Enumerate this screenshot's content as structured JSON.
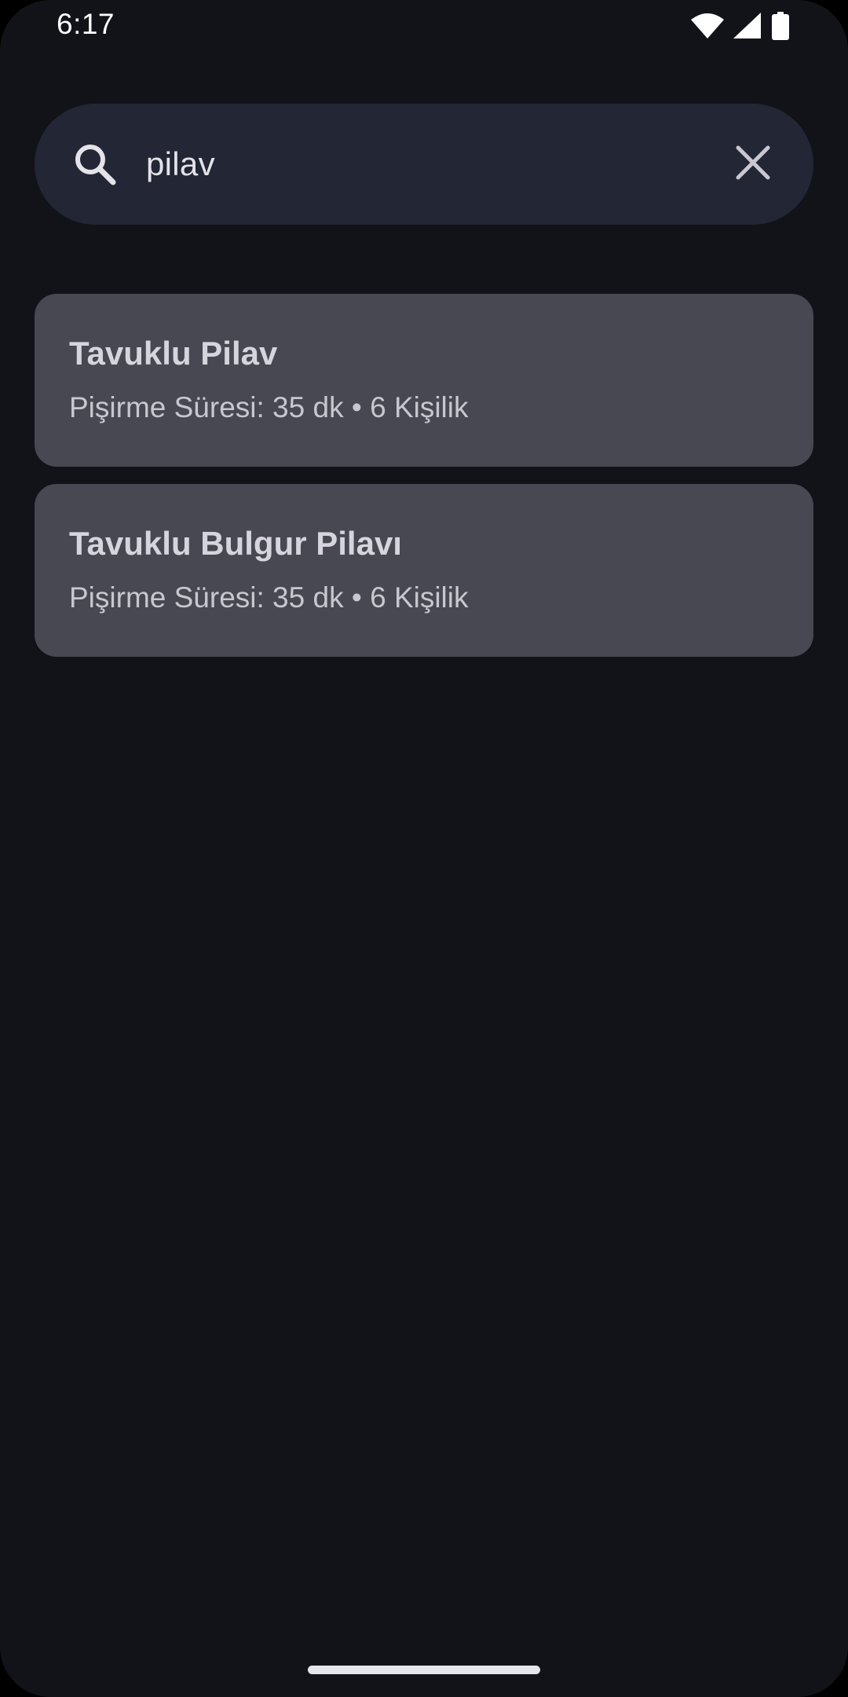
{
  "status_bar": {
    "time": "6:17",
    "icons": [
      "wifi-icon",
      "cellular-signal-icon",
      "battery-icon"
    ]
  },
  "search": {
    "query": "pilav",
    "search_icon": "search-icon",
    "clear_icon": "close-icon"
  },
  "results": [
    {
      "title": "Tavuklu Pilav",
      "meta": "Pişirme Süresi: 35 dk • 6 Kişilik"
    },
    {
      "title": "Tavuklu Bulgur Pilavı",
      "meta": "Pişirme Süresi: 35 dk • 6 Kişilik"
    }
  ],
  "colors": {
    "background": "#121318",
    "search_bar": "#232634",
    "card": "#484852",
    "text_primary": "#d6d5de"
  }
}
